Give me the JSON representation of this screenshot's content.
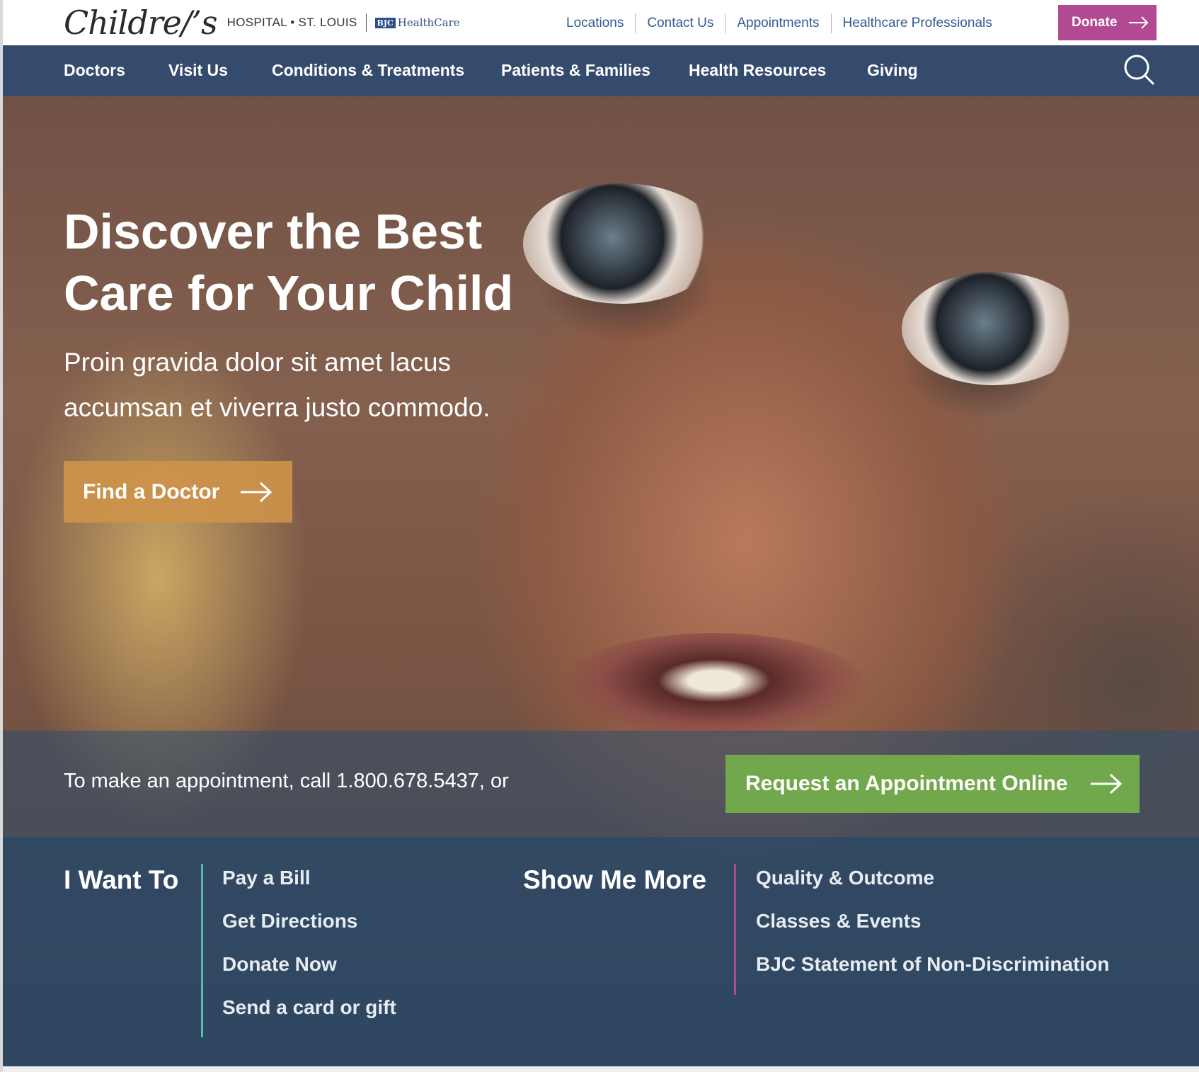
{
  "header": {
    "logo_word": "Childre∕’s",
    "logo_sub": "HOSPITAL • ST. LOUIS",
    "bjc_badge": "BJC",
    "bjc_text": "HealthCare",
    "utility_links": [
      "Locations",
      "Contact Us",
      "Appointments",
      "Healthcare Professionals"
    ],
    "donate_label": "Donate"
  },
  "main_nav": {
    "items": [
      "Doctors",
      "Visit Us",
      "Conditions & Treatments",
      "Patients & Families",
      "Health Resources",
      "Giving"
    ]
  },
  "hero": {
    "headline_line1": "Discover the Best",
    "headline_line2": "Care for Your Child",
    "subline_line1": "Proin gravida dolor sit amet lacus",
    "subline_line2": "accumsan et viverra justo commodo.",
    "cta_label": "Find a Doctor"
  },
  "appointment": {
    "text": "To make an appointment, call 1.800.678.5437, or",
    "button_label": "Request an Appointment Online"
  },
  "quick_links": {
    "i_want_to": {
      "title": "I Want To",
      "items": [
        "Pay a Bill",
        "Get Directions",
        "Donate Now",
        "Send a card or gift"
      ]
    },
    "show_me_more": {
      "title": "Show Me More",
      "items": [
        "Quality & Outcome",
        "Classes & Events",
        "BJC Statement of Non-Discrimination"
      ]
    }
  },
  "colors": {
    "brand_blue": "#2f5b91",
    "donate_magenta": "#b24a93",
    "cta_gold": "#cd924a",
    "cta_green": "#71a84c",
    "rule_teal": "#5fb3b3",
    "rule_magenta": "#b24a93"
  }
}
